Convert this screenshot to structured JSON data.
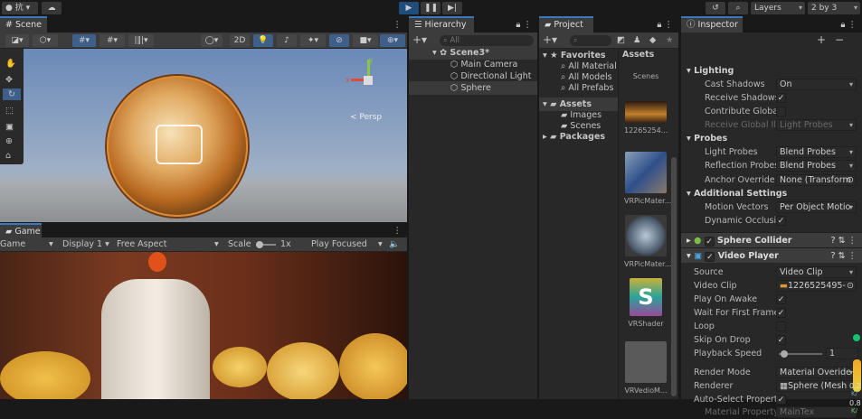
{
  "topbar": {
    "account": "抗",
    "layers": "Layers",
    "layout": "2 by 3"
  },
  "scene": {
    "tab": "Scene",
    "btn_2d": "2D",
    "persp": "< Persp",
    "gizmo_axes": [
      "x",
      "y",
      "z"
    ]
  },
  "game": {
    "tab": "Game",
    "mode": "Game",
    "display": "Display 1",
    "aspect": "Free Aspect",
    "scale_label": "Scale",
    "scale_value": "1x",
    "play_mode": "Play Focused"
  },
  "hierarchy": {
    "tab": "Hierarchy",
    "search_placeholder": "All",
    "scene": "Scene3*",
    "items": [
      "Main Camera",
      "Directional Light",
      "Sphere"
    ]
  },
  "project": {
    "tab": "Project",
    "favorites": "Favorites",
    "fav_items": [
      "All Material",
      "All Models",
      "All Prefabs"
    ],
    "assets": "Assets",
    "asset_folders": [
      "Images",
      "Scenes"
    ],
    "packages": "Packages",
    "grid_header": "Assets",
    "grid_items": [
      "Scenes",
      "12265254...",
      "VRPicMater...",
      "VRPicMater...",
      "VRShader",
      "VRVedioM..."
    ]
  },
  "inspector": {
    "tab": "Inspector",
    "lighting": "Lighting",
    "cast_shadows": "Cast Shadows",
    "cast_shadows_val": "On",
    "receive_shadows": "Receive Shadows",
    "contribute_gi": "Contribute Global",
    "receive_gi": "Receive Global Ill",
    "receive_gi_val": "Light Probes",
    "probes": "Probes",
    "light_probes": "Light Probes",
    "light_probes_val": "Blend Probes",
    "reflection_probes": "Reflection Probes",
    "reflection_probes_val": "Blend Probes",
    "anchor_override": "Anchor Override",
    "anchor_override_val": "None (Transform",
    "additional": "Additional Settings",
    "motion_vectors": "Motion Vectors",
    "motion_vectors_val": "Per Object Motio",
    "dynamic_occlusion": "Dynamic Occlusic",
    "sphere_collider": "Sphere Collider",
    "video_player": "Video Player",
    "source": "Source",
    "source_val": "Video Clip",
    "video_clip": "Video Clip",
    "video_clip_val": "1226525495-1",
    "play_on_awake": "Play On Awake",
    "wait_first_frame": "Wait For First Frame",
    "loop": "Loop",
    "skip_on_drop": "Skip On Drop",
    "playback_speed": "Playback Speed",
    "playback_speed_val": "1",
    "render_mode": "Render Mode",
    "render_mode_val": "Material Overide",
    "renderer": "Renderer",
    "renderer_val": "Sphere (Mesh",
    "auto_select": "Auto-Select Property",
    "material_property": "Material Property",
    "material_property_val": "MainTex",
    "stats": [
      "0.2",
      "K/",
      "0.8",
      "K/"
    ]
  },
  "colors": {
    "accent": "#3a79bb",
    "play_active": "#1f4e7d",
    "panel": "#282828",
    "header": "#3c3c3c"
  }
}
